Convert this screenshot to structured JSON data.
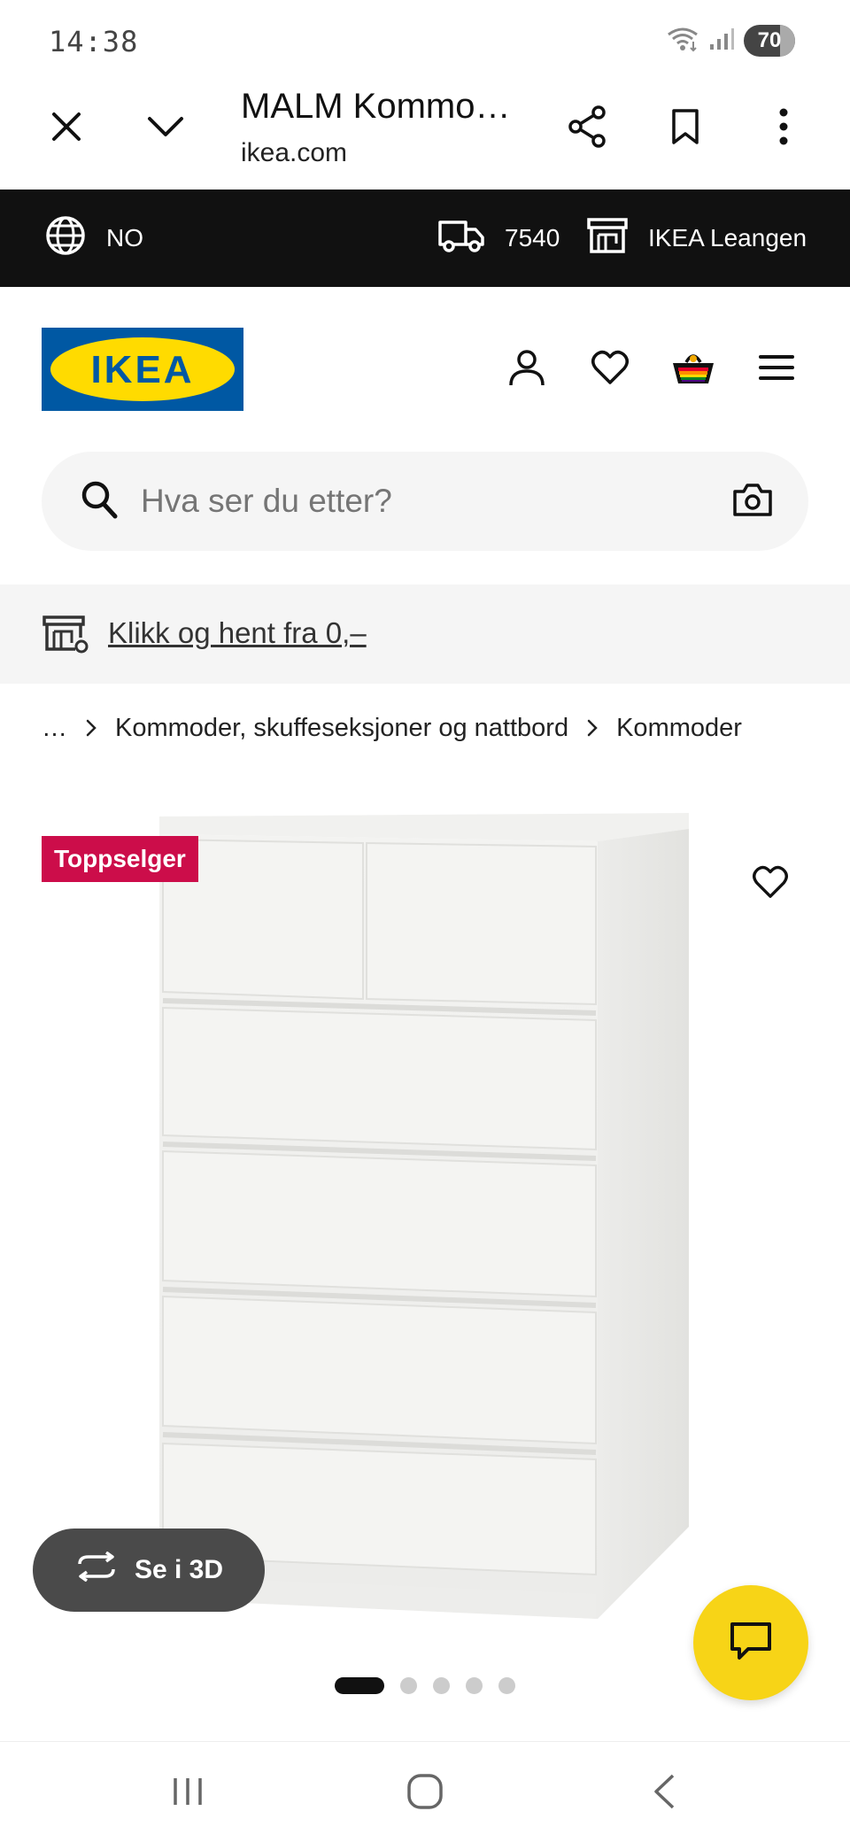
{
  "status_bar": {
    "time": "14:38",
    "battery": "70"
  },
  "browser": {
    "title": "MALM Kommo…",
    "domain": "ikea.com"
  },
  "top_strip": {
    "country": "NO",
    "postcode": "7540",
    "store": "IKEA Leangen"
  },
  "header": {
    "logo_text": "IKEA"
  },
  "search": {
    "placeholder": "Hva ser du etter?"
  },
  "promo": {
    "link_text": "Klikk og hent fra 0,–"
  },
  "breadcrumb": {
    "items": [
      "…",
      "Kommoder, skuffeseksjoner og nattbord",
      "Kommoder"
    ]
  },
  "product": {
    "badge": "Toppselger",
    "see_3d_label": "Se i 3D",
    "image_count": 5,
    "active_image": 0
  },
  "colors": {
    "ikea_blue": "#0058a3",
    "ikea_yellow": "#ffdb00",
    "badge_red": "#cc0d4a",
    "chat_yellow": "#f7d417"
  }
}
